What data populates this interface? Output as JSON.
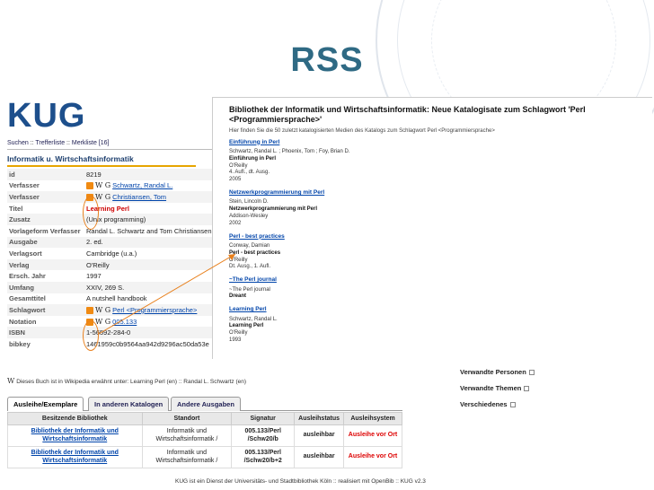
{
  "slide": {
    "title": "RSS"
  },
  "kug": {
    "logo": "KUG",
    "nav": {
      "suchen": "Suchen",
      "sep1": " :: ",
      "trefferliste": "Trefferliste",
      "sep2": " :: ",
      "merkliste": "Merkliste [16]"
    },
    "section_title": "Informatik u. Wirtschaftsinformatik",
    "rows": [
      {
        "label": "id",
        "value": "8219"
      },
      {
        "label": "Verfasser",
        "value": "Schwartz, Randal L.",
        "icons": true
      },
      {
        "label": "Verfasser",
        "value": "Christiansen, Tom",
        "icons": true
      },
      {
        "label": "Titel",
        "value": "Learning Perl"
      },
      {
        "label": "Zusatz",
        "value": "(Unix programming)"
      },
      {
        "label": "Vorlageform Verfasser",
        "value": "Randal L. Schwartz and Tom Christiansen"
      },
      {
        "label": "Ausgabe",
        "value": "2. ed."
      },
      {
        "label": "Verlagsort",
        "value": "Cambridge (u.a.)"
      },
      {
        "label": "Verlag",
        "value": "O'Reilly"
      },
      {
        "label": "Ersch. Jahr",
        "value": "1997"
      },
      {
        "label": "Umfang",
        "value": "XXIV, 269 S."
      },
      {
        "label": "Gesamttitel",
        "value": "A nutshell handbook"
      },
      {
        "label": "Schlagwort",
        "value": "Perl <Programmiersprache>",
        "icons": true
      },
      {
        "label": "Notation",
        "value": "005.133",
        "icons": true
      },
      {
        "label": "ISBN",
        "value": "1-56592-284-0"
      },
      {
        "label": "bibkey",
        "value": "1461959c0b9564aa942d9296ac50da53e"
      }
    ],
    "wiki_line": "Dieses Buch ist in Wikipedia erwähnt unter: Learning Perl (en) :: Randal L. Schwartz (en)",
    "tabs": [
      "Ausleihe/Exemplare",
      "In anderen Katalogen",
      "Andere Ausgaben"
    ],
    "holdings": {
      "headers": [
        "Besitzende Bibliothek",
        "Standort",
        "Signatur",
        "Ausleihstatus",
        "Ausleihsystem"
      ],
      "rows": [
        {
          "lib": "Bibliothek der Informatik und Wirtschaftsinformatik",
          "loc": "Informatik und Wirtschaftsinformatik /",
          "sig": "005.133/Perl /Schw20/b",
          "status": "ausleihbar",
          "system": "Ausleihe vor Ort"
        },
        {
          "lib": "Bibliothek der Informatik und Wirtschaftsinformatik",
          "loc": "Informatik und Wirtschaftsinformatik /",
          "sig": "005.133/Perl /Schw20/b+2",
          "status": "ausleihbar",
          "system": "Ausleihe vor Ort"
        }
      ]
    },
    "footer": "KUG ist ein Dienst der Universitäts- und Stadtbibliothek Köln :: realisiert mit OpenBib :: KUG v2.3"
  },
  "rss": {
    "title": "Bibliothek der Informatik und Wirtschaftsinformatik: Neue Katalogisate zum Schlagwort 'Perl <Programmiersprache>'",
    "subtitle": "Hier finden Sie die 50 zuletzt katalogisierten Medien des Katalogs zum Schlagwort Perl <Programmiersprache>",
    "items": [
      {
        "head": "Einführung in Perl",
        "lines": [
          "Schwartz, Randal L. ; Phoenix, Tom ; Foy, Brian D.",
          "Einführung in Perl",
          "O'Reilly",
          "4. Aufl., dt. Ausg.",
          "2005"
        ]
      },
      {
        "head": "Netzwerkprogrammierung mit Perl",
        "lines": [
          "Stein, Lincoln D.",
          "Netzwerkprogrammierung mit Perl",
          "Addison-Wesley",
          "2002"
        ]
      },
      {
        "head": "Perl - best practices",
        "lines": [
          "Conway, Damian",
          "Perl - best practices",
          "O'Reilly",
          "Dt. Ausg., 1. Aufl."
        ]
      },
      {
        "head": "~The Perl journal",
        "lines": [
          "~The Perl journal",
          "Dreant"
        ]
      },
      {
        "head": "Learning Perl",
        "lines": [
          "Schwartz, Randal L.",
          "Learning Perl",
          "O'Reilly",
          "1993"
        ]
      }
    ]
  },
  "related": [
    "Verwandte Personen",
    "Verwandte Themen",
    "Verschiedenes"
  ],
  "colors": {
    "title": "#2f6a84",
    "rss": "#f08a12",
    "link": "#0044aa",
    "lend": "#dd0000"
  }
}
